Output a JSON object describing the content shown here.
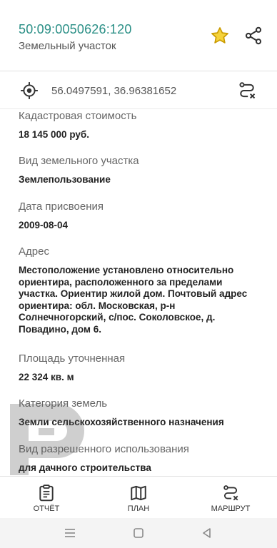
{
  "header": {
    "cadastral_number": "50:09:0050626:120",
    "subtitle": "Земельный участок",
    "icons": {
      "favorite": "star-icon",
      "share": "share-icon"
    },
    "colors": {
      "accent": "#2a8f86",
      "star": "#f0c21a"
    }
  },
  "coords": {
    "text": "56.0497591, 36.96381652",
    "icons": {
      "locate": "crosshair-icon",
      "route": "route-icon"
    }
  },
  "details": [
    {
      "label": "Кадастровая стоимость",
      "value": "18 145 000 руб."
    },
    {
      "label": "Вид земельного участка",
      "value": "Землепользование"
    },
    {
      "label": "Дата присвоения",
      "value": "2009-08-04"
    },
    {
      "label": "Адрес",
      "value": "Местоположение установлено относительно ориентира, расположенного за пределами участка. Ориентир жилой дом. Почтовый адрес ориентира: обл. Московская, р-н Солнечногорский, с/пос. Соколовское, д. Повадино, дом 6."
    },
    {
      "label": "Площадь уточненная",
      "value": "22 324 кв. м"
    },
    {
      "label": "Категория земель",
      "value": "Земли сельскохозяйственного назначения"
    },
    {
      "label": "Вид разрешенного использования",
      "value": "для дачного строительства"
    }
  ],
  "watermark": {
    "text": "ОГРК"
  },
  "bottom_nav": [
    {
      "label": "ОТЧЁТ",
      "icon": "report-icon"
    },
    {
      "label": "ПЛАН",
      "icon": "map-icon"
    },
    {
      "label": "МАРШРУТ",
      "icon": "route-icon"
    }
  ],
  "system_nav": {
    "icons": [
      "menu-icon",
      "home-icon",
      "back-icon"
    ]
  }
}
